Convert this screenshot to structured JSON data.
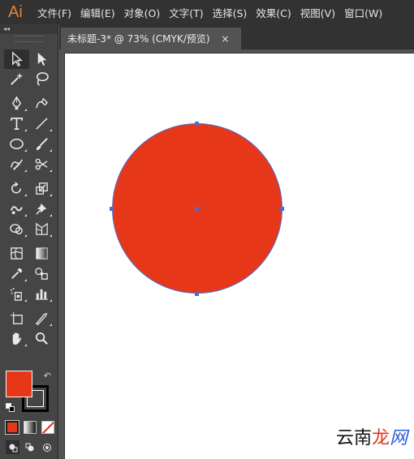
{
  "app": {
    "logo": "Ai"
  },
  "menu": [
    "文件(F)",
    "编辑(E)",
    "对象(O)",
    "文字(T)",
    "选择(S)",
    "效果(C)",
    "视图(V)",
    "窗口(W)"
  ],
  "panel": {
    "collapse_glyph": "◂◂"
  },
  "document_tab": {
    "title": "未标题-3* @ 73% (CMYK/预览)",
    "close_glyph": "×"
  },
  "colors": {
    "fill": "#e63819",
    "selection": "#4a6cd4"
  },
  "tools": [
    [
      "selection-tool",
      "direct-selection-tool"
    ],
    [
      "magic-wand-tool",
      "lasso-tool"
    ],
    [
      "pen-tool",
      "curvature-tool"
    ],
    [
      "type-tool",
      "line-segment-tool"
    ],
    [
      "ellipse-tool",
      "paintbrush-tool"
    ],
    [
      "shaper-tool",
      "scissors-tool"
    ],
    [
      "rotate-tool",
      "scale-tool"
    ],
    [
      "puppet-warp-tool",
      "pin-tool"
    ],
    [
      "shape-builder-tool",
      "perspective-grid-tool"
    ],
    [
      "mesh-tool",
      "gradient-tool"
    ],
    [
      "eyedropper-tool",
      "blend-tool"
    ],
    [
      "symbol-sprayer-tool",
      "column-graph-tool"
    ],
    [
      "artboard-tool",
      "slice-tool"
    ],
    [
      "hand-tool",
      "zoom-tool"
    ]
  ],
  "watermark": {
    "part1": "云南",
    "part2": "龙",
    "part3": "网"
  }
}
